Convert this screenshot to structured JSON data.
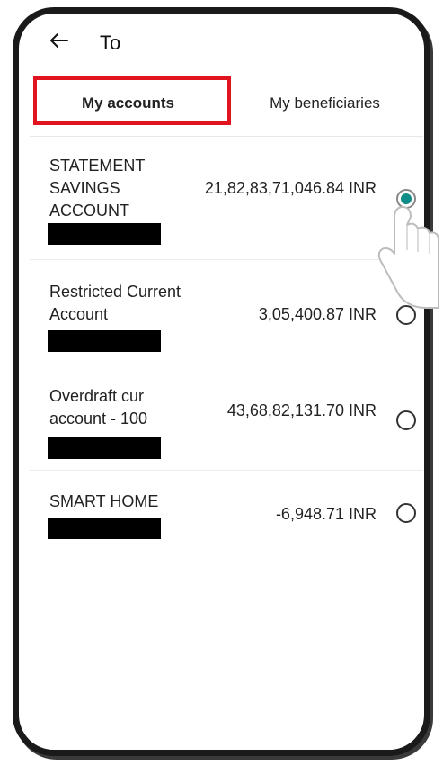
{
  "header": {
    "title": "To"
  },
  "tabs": [
    {
      "label": "My accounts",
      "active": true
    },
    {
      "label": "My beneficiaries",
      "active": false
    }
  ],
  "accounts": [
    {
      "name": "STATEMENT SAVINGS ACCOUNT",
      "balance": "21,82,83,71,046.84 INR",
      "selected": true
    },
    {
      "name": "Restricted Current Account",
      "balance": "3,05,400.87 INR",
      "selected": false
    },
    {
      "name": "Overdraft cur account - 100",
      "balance": "43,68,82,131.70 INR",
      "selected": false
    },
    {
      "name": "SMART HOME",
      "balance": "-6,948.71 INR",
      "selected": false
    }
  ],
  "colors": {
    "radio_selected": "#0f8c86",
    "highlight_box": "#e0141e"
  },
  "icons": {
    "back": "arrow-left-icon",
    "pointer": "hand-pointer-icon"
  }
}
